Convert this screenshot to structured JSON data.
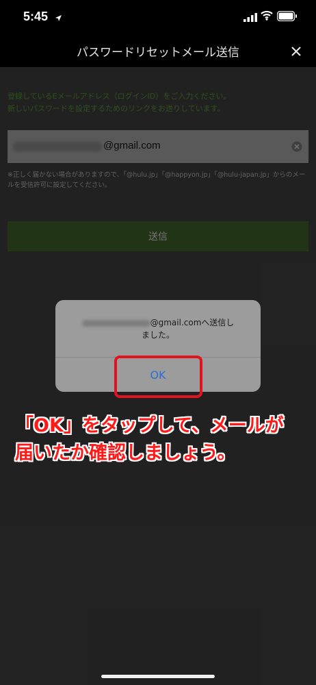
{
  "status_bar": {
    "time": "5:45"
  },
  "nav": {
    "title": "パスワードリセットメール送信"
  },
  "form": {
    "intro_line1": "登録しているEメールアドレス（ログインID）をご入力ください。",
    "intro_line2": "新しいパスワードを設定するためのリンクをお送りしています。",
    "email_visible_part": "@gmail.com",
    "note": "※正しく届かない場合がありますので、「@hulu.jp」「@happyon.jp」「@hulu-japan.jp」からのメールを受信許可に設定してください。",
    "submit_label": "送信"
  },
  "dialog": {
    "message_suffix": "@gmail.comへ送信し",
    "message_line2": "ました。",
    "ok_label": "OK"
  },
  "annotation": {
    "line1": "「OK」をタップして、メールが",
    "line2": "届いたか確認しましょう。"
  },
  "colors": {
    "accent_green": "#4f8a2e",
    "button_green": "#3b5a27",
    "ok_blue": "#2b6fd6",
    "annotation_red": "#ff1a1a"
  }
}
